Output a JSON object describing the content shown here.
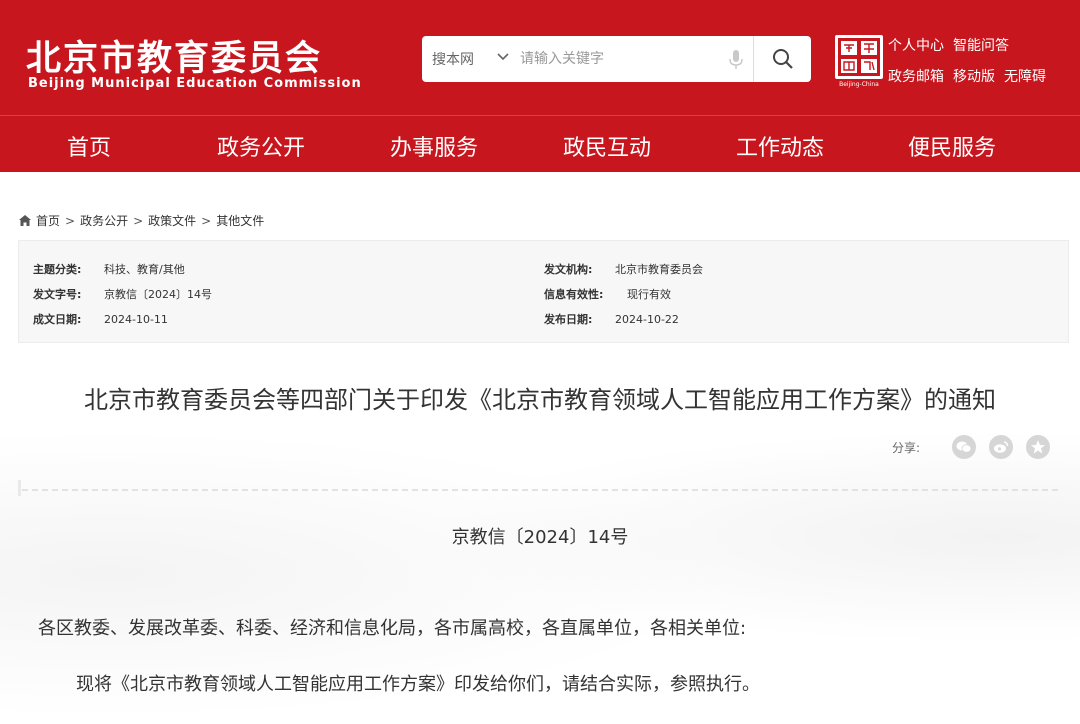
{
  "header": {
    "site_name_cn": "北京市教育委员会",
    "site_name_en": "Beijing Municipal Education Commission",
    "badge_text": "Beijing-China",
    "top_links": [
      "个人中心",
      "智能问答",
      "政务邮箱",
      "移动版",
      "无障碍"
    ]
  },
  "search": {
    "scope": "搜本网",
    "placeholder": "请输入关键字"
  },
  "nav": {
    "items": [
      "首页",
      "政务公开",
      "办事服务",
      "政民互动",
      "工作动态",
      "便民服务"
    ]
  },
  "breadcrumb": [
    "首页",
    "政务公开",
    "政策文件",
    "其他文件"
  ],
  "meta": {
    "topic_label": "主题分类:",
    "topic_value": "科技、教育/其他",
    "doc_no_label": "发文字号:",
    "doc_no_value": "京教信〔2024〕14号",
    "created_label": "成文日期:",
    "created_value": "2024-10-11",
    "issuer_label": "发文机构:",
    "issuer_value": "北京市教育委员会",
    "validity_label": "信息有效性:",
    "validity_value": "现行有效",
    "published_label": "发布日期:",
    "published_value": "2024-10-22"
  },
  "article": {
    "title": "北京市教育委员会等四部门关于印发《北京市教育领域人工智能应用工作方案》的通知",
    "share_label": "分享:",
    "doc_number": "京教信〔2024〕14号",
    "recipients": "各区教委、发展改革委、科委、经济和信息化局，各市属高校，各直属单位，各相关单位:",
    "body": "现将《北京市教育领域人工智能应用工作方案》印发给你们，请结合实际，参照执行。"
  },
  "colors": {
    "brand_red": "#c8161e"
  }
}
